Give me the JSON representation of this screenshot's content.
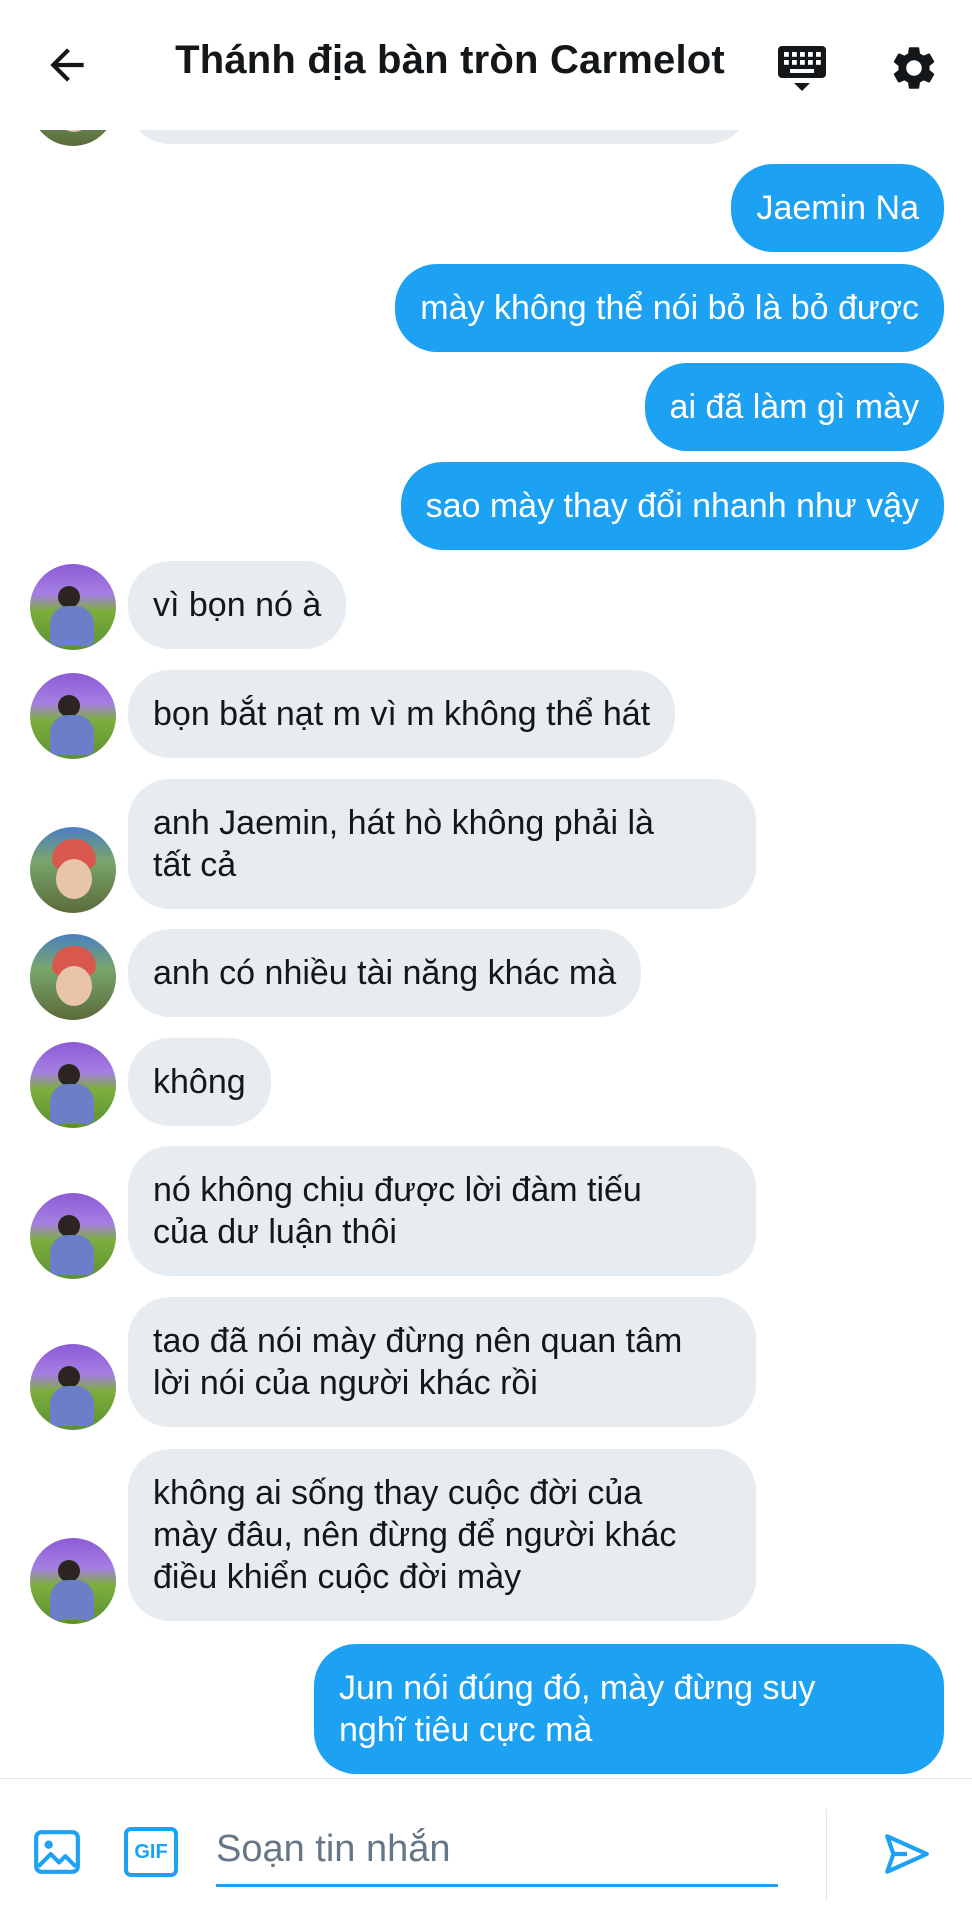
{
  "header": {
    "title": "Thánh địa bàn tròn Carmelot",
    "back_icon": "arrow-left-icon",
    "keyboard_icon": "keyboard-icon",
    "settings_icon": "gear-icon"
  },
  "colors": {
    "accent": "#1da1f2",
    "incoming_bubble": "#e6ecf0",
    "text": "#14171a"
  },
  "messages": [
    {
      "dir": "out",
      "text": "Jaemin Na"
    },
    {
      "dir": "out",
      "text": "mày không thể nói bỏ là bỏ được"
    },
    {
      "dir": "out",
      "text": "ai đã làm gì mày"
    },
    {
      "dir": "out",
      "text": "sao mày thay đổi nhanh như vậy"
    },
    {
      "dir": "in",
      "avatar": "a",
      "lines": [
        "vì bọn nó à"
      ]
    },
    {
      "dir": "in",
      "avatar": "a",
      "lines": [
        "bọn bắt nạt m vì m không thể hát"
      ]
    },
    {
      "dir": "in",
      "avatar": "b",
      "lines": [
        "anh Jaemin, hát hò không phải là",
        "tất cả"
      ]
    },
    {
      "dir": "in",
      "avatar": "b",
      "lines": [
        "anh có nhiều tài năng khác mà"
      ]
    },
    {
      "dir": "in",
      "avatar": "a",
      "lines": [
        "không"
      ]
    },
    {
      "dir": "in",
      "avatar": "a",
      "lines": [
        "nó không chịu được lời đàm tiếu",
        "của dư luận thôi"
      ]
    },
    {
      "dir": "in",
      "avatar": "a",
      "lines": [
        "tao đã nói mày đừng nên quan tâm",
        "lời nói của người khác rồi"
      ]
    },
    {
      "dir": "in",
      "avatar": "a",
      "lines": [
        "không ai sống thay cuộc đời của",
        "mày đâu, nên đừng để người khác",
        "điều khiển cuộc đời mày"
      ]
    },
    {
      "dir": "out",
      "lines": [
        "Jun nói đúng đó, mày đừng suy",
        "nghĩ tiêu cực mà"
      ]
    }
  ],
  "composer": {
    "placeholder": "Soạn tin nhắn",
    "gif_label": "GIF",
    "image_icon": "image-icon",
    "send_icon": "send-icon"
  }
}
